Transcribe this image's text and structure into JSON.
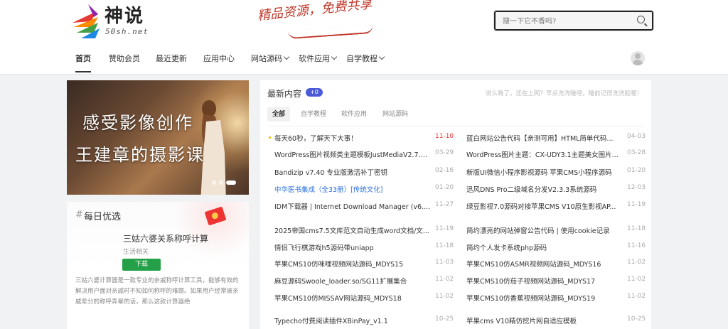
{
  "site": {
    "logo_text": "神说",
    "logo_sub": "50sh.net",
    "slogan": "精品资源，免费共享"
  },
  "search": {
    "placeholder": "搜一下它不香吗?"
  },
  "nav": [
    {
      "label": "首页",
      "has_menu": false,
      "active": true
    },
    {
      "label": "赞助会员",
      "has_menu": false
    },
    {
      "label": "最近更新",
      "has_menu": false
    },
    {
      "label": "应用中心",
      "has_menu": false
    },
    {
      "label": "网站源码",
      "has_menu": true
    },
    {
      "label": "软件应用",
      "has_menu": true
    },
    {
      "label": "自学教程",
      "has_menu": true
    }
  ],
  "banner": {
    "line1": "感受影像创作",
    "line2": "王建章的摄影课",
    "slide_count": 3,
    "active_slide": 3
  },
  "daily": {
    "hash": "#",
    "title": "每日优选",
    "app_name": "三姑六婆关系称呼计算",
    "app_category": "生活相关",
    "download_label": "下载",
    "description": "三姑六婆计算器是一款专业的亲戚称呼计算工具，能够有效的解决用户面对亲戚时不知如何称呼的难题。如果用户经常被亲戚辈分的称呼弄晕的话，那么这款计算器绝"
  },
  "content": {
    "title": "最新内容",
    "badge": "+0",
    "right_note": "说么晚了，还在上网？早点洗洗睡吧，睡前记得洗洗脸喔！",
    "tabs": [
      "全部",
      "自学教程",
      "软件应用",
      "网站源码"
    ],
    "left_items": [
      {
        "title": "每天60秒，了解天下大事！",
        "date": "11-10",
        "highlight": "red",
        "pinned": true
      },
      {
        "title": "WordPress图片视频类主题模板JustMediaV2.7.1...",
        "date": "03-29"
      },
      {
        "title": "Bandizip v7.40 专业版激活补丁密钥",
        "date": "02-16"
      },
      {
        "title": "中华医书集成（全33册）[传统文化]",
        "date": "01-20",
        "highlight": "blue"
      },
      {
        "title": "IDM下载器 | Internet Download Manager (v6....",
        "date": "11-27"
      },
      {
        "title": "2025帝国cms7.5文库范文自动生成word文档/文...",
        "date": "11-19"
      },
      {
        "title": "情侣飞行棋游戏h5源码带uniapp",
        "date": "11-18"
      },
      {
        "title": "苹果CMS10仿咪哩视频网站源码_MDYS15",
        "date": "11-03"
      },
      {
        "title": "麻豆源码Swoole_loader.so/SG11扩展集合",
        "date": "11-02"
      },
      {
        "title": "苹果CMS10仿MISSAV网站源码_MDYS18",
        "date": "11-02"
      },
      {
        "title": "Typecho付费阅读插件XBinPay_v1.1",
        "date": "10-25"
      }
    ],
    "right_items": [
      {
        "title": "蓝白网站公告代码【亲测可用】HTML简单代码...",
        "date": "04-03"
      },
      {
        "title": "WordPress图片主题：CX-UDY3.1主题美女图片...",
        "date": "03-28"
      },
      {
        "title": "新版UI微信小程序影视源码 苹果CMS小程序源码",
        "date": "01-20"
      },
      {
        "title": "迅风DNS Pro二级域名分发V2.3.3系统源码",
        "date": "12-03"
      },
      {
        "title": "绿豆影视7.0源码对接苹果CMS V10原生影视AP...",
        "date": "11-19"
      },
      {
        "title": "简约漂亮的网站弹窗公告代码 | 使用cookie记录",
        "date": "11-18"
      },
      {
        "title": "简约个人发卡系统php源码",
        "date": "11-16"
      },
      {
        "title": "苹果CMS10仿ASMR视频网站源码_MDYS16",
        "date": "11-02"
      },
      {
        "title": "苹果CMS10仿茄子视频网站源码_MDYS17",
        "date": "11-02"
      },
      {
        "title": "苹果CMS10仿香蕉视频网站源码_MDYS19",
        "date": "11-02"
      },
      {
        "title": "苹果cms V10精仿挖片网自适应模板",
        "date": "10-25"
      }
    ]
  },
  "colors": {
    "accent": "#4b5bd8",
    "download_green": "#24a148",
    "hot_red": "#e33333",
    "link_blue": "#2a6fdb"
  }
}
